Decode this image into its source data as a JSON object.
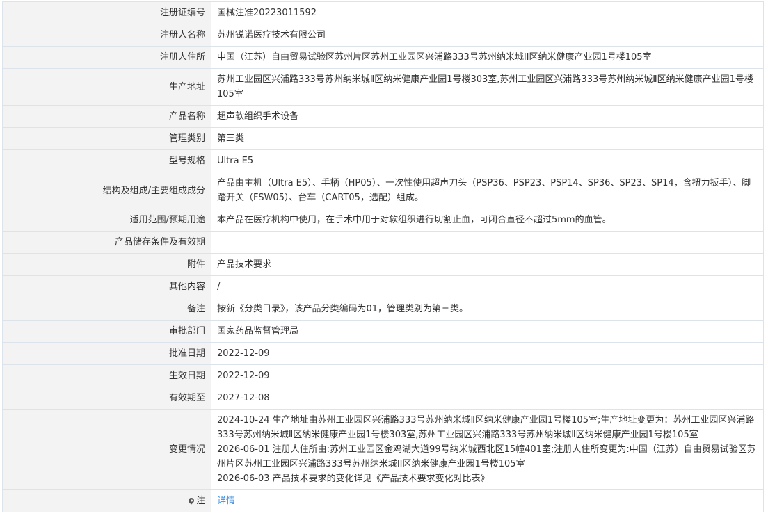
{
  "record": {
    "reg_no": {
      "label": "注册证编号",
      "value": "国械注准20223011592"
    },
    "registrant_name": {
      "label": "注册人名称",
      "value": "苏州锐诺医疗技术有限公司"
    },
    "registrant_address": {
      "label": "注册人住所",
      "value": "中国（江苏）自由贸易试验区苏州片区苏州工业园区兴浦路333号苏州纳米城II区纳米健康产业园1号楼105室"
    },
    "production_address": {
      "label": "生产地址",
      "value": "苏州工业园区兴浦路333号苏州纳米城Ⅱ区纳米健康产业园1号楼303室,苏州工业园区兴浦路333号苏州纳米城Ⅱ区纳米健康产业园1号楼105室"
    },
    "product_name": {
      "label": "产品名称",
      "value": "超声软组织手术设备"
    },
    "management_class": {
      "label": "管理类别",
      "value": "第三类"
    },
    "model_spec": {
      "label": "型号规格",
      "value": "Ultra E5"
    },
    "structure": {
      "label": "结构及组成/主要组成成分",
      "value": "产品由主机（Ultra E5）、手柄（HP05）、一次性使用超声刀头（PSP36、PSP23、PSP14、SP36、SP23、SP14，含扭力扳手）、脚踏开关（FSW05）、台车（CART05，选配）组成。"
    },
    "intended_use": {
      "label": "适用范围/预期用途",
      "value": "本产品在医疗机构中使用，在手术中用于对软组织进行切割止血，可闭合直径不超过5mm的血管。"
    },
    "storage": {
      "label": "产品储存条件及有效期",
      "value": ""
    },
    "attachment": {
      "label": "附件",
      "value": "产品技术要求"
    },
    "other": {
      "label": "其他内容",
      "value": "/"
    },
    "remark": {
      "label": "备注",
      "value": "按新《分类目录》，该产品分类编码为01，管理类别为第三类。"
    },
    "approval_dept": {
      "label": "审批部门",
      "value": "国家药品监督管理局"
    },
    "approval_date": {
      "label": "批准日期",
      "value": "2022-12-09"
    },
    "effective_date": {
      "label": "生效日期",
      "value": "2022-12-09"
    },
    "valid_until": {
      "label": "有效期至",
      "value": "2027-12-08"
    },
    "changes": {
      "label": "变更情况",
      "entries": [
        "2024-10-24 生产地址由苏州工业园区兴浦路333号苏州纳米城Ⅱ区纳米健康产业园1号楼105室;生产地址变更为：苏州工业园区兴浦路333号苏州纳米城Ⅱ区纳米健康产业园1号楼303室,苏州工业园区兴浦路333号苏州纳米城Ⅱ区纳米健康产业园1号楼105室",
        "2026-06-01 注册人住所由:苏州工业园区金鸡湖大道99号纳米城西北区15幢401室;注册人住所变更为:中国（江苏）自由贸易试验区苏州片区苏州工业园区兴浦路333号苏州纳米城II区纳米健康产业园1号楼105室",
        "2026-06-03 产品技术要求的变化详见《产品技术要求变化对比表》"
      ]
    },
    "note": {
      "label": "注",
      "icon": "location-pin-icon",
      "link": "详情"
    }
  },
  "colors": {
    "label_bg": "#f3f3f3",
    "border": "#dde3ea",
    "text": "#333333",
    "link": "#3a8ee6"
  }
}
